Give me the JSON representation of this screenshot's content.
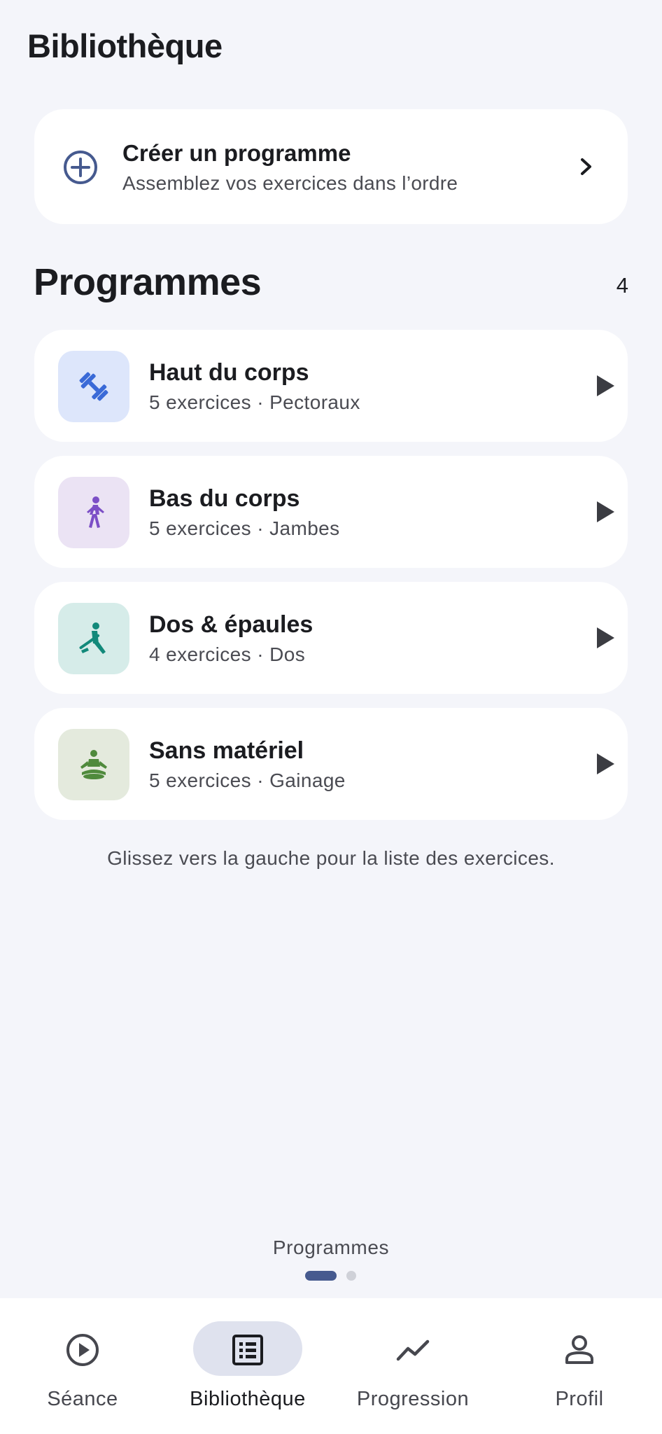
{
  "header": {
    "title": "Bibliothèque"
  },
  "create": {
    "title": "Créer un programme",
    "subtitle": "Assemblez vos exercices dans l’ordre"
  },
  "section": {
    "title": "Programmes",
    "count": "4"
  },
  "programs": [
    {
      "title": "Haut du corps",
      "subtitle": "5 exercices · Pectoraux",
      "icon": "dumbbell-icon",
      "tile_color": "#dde6fb",
      "icon_color": "#3a6ad7"
    },
    {
      "title": "Bas du corps",
      "subtitle": "5 exercices · Jambes",
      "icon": "walking-icon",
      "tile_color": "#ebe3f4",
      "icon_color": "#7c4fc6"
    },
    {
      "title": "Dos & épaules",
      "subtitle": "4 exercices · Dos",
      "icon": "rowing-icon",
      "tile_color": "#d6ece9",
      "icon_color": "#12897a"
    },
    {
      "title": "Sans matériel",
      "subtitle": "5 exercices · Gainage",
      "icon": "meditation-icon",
      "tile_color": "#e4eadd",
      "icon_color": "#4f8a3c"
    }
  ],
  "hint": "Glissez vers la gauche pour la liste des exercices.",
  "pager": {
    "label": "Programmes",
    "active_index": 0,
    "pages": 2
  },
  "nav": {
    "items": [
      {
        "label": "Séance",
        "icon": "play-circle-icon"
      },
      {
        "label": "Bibliothèque",
        "icon": "list-icon",
        "active": true
      },
      {
        "label": "Progression",
        "icon": "trending-icon"
      },
      {
        "label": "Profil",
        "icon": "person-icon"
      }
    ]
  },
  "colors": {
    "accent": "#465a8f",
    "background": "#f4f5fa"
  }
}
